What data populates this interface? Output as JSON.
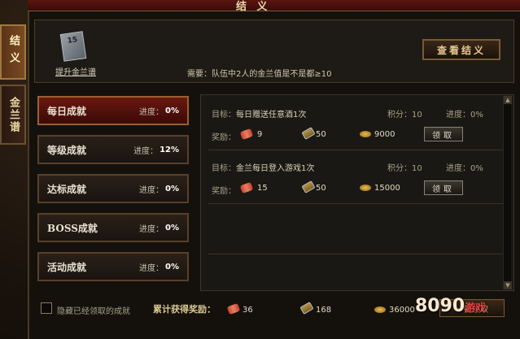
{
  "window": {
    "title": "结 义"
  },
  "side_tabs": [
    {
      "label": "结义",
      "active": true
    },
    {
      "label": "金兰谱",
      "active": false
    }
  ],
  "header": {
    "book_label": "提升金兰谱",
    "book_badge": "15",
    "requirement": "需要：队伍中2人的金兰值是不是都≥10",
    "view_button": "查看结义"
  },
  "categories": [
    {
      "name": "每日成就",
      "progress_label": "进度：",
      "progress": "0%",
      "active": true
    },
    {
      "name": "等级成就",
      "progress_label": "进度：",
      "progress": "12%",
      "active": false
    },
    {
      "name": "达标成就",
      "progress_label": "进度：",
      "progress": "0%",
      "active": false
    },
    {
      "name": "BOSS成就",
      "progress_label": "进度：",
      "progress": "0%",
      "active": false
    },
    {
      "name": "活动成就",
      "progress_label": "进度：",
      "progress": "0%",
      "active": false
    }
  ],
  "quests": [
    {
      "target_label": "目标：",
      "target": "每日赠送任意酒1次",
      "points_label": "积分：",
      "points": "10",
      "progress_label": "进度：",
      "progress": "0%",
      "reward_label": "奖励：",
      "rewards": [
        "9",
        "50",
        "9000"
      ],
      "claim": "领取"
    },
    {
      "target_label": "目标：",
      "target": "金兰每日登入游戏1次",
      "points_label": "积分：",
      "points": "10",
      "progress_label": "进度：",
      "progress": "0%",
      "reward_label": "奖励：",
      "rewards": [
        "15",
        "50",
        "15000"
      ],
      "claim": "领取"
    }
  ],
  "footer": {
    "hide_claimed": "隐藏已经领取的成就",
    "total_label": "累计获得奖励：",
    "totals": [
      "36",
      "168",
      "36000"
    ],
    "claim_all": "一键领取"
  },
  "watermark": {
    "text": "8090",
    "sub": "游戏"
  },
  "colors": {
    "accent": "#6a1810",
    "gold": "#e8c890",
    "panel": "#1a1814"
  },
  "icons": [
    "scroll-icon",
    "book-icon",
    "gold-icon"
  ]
}
